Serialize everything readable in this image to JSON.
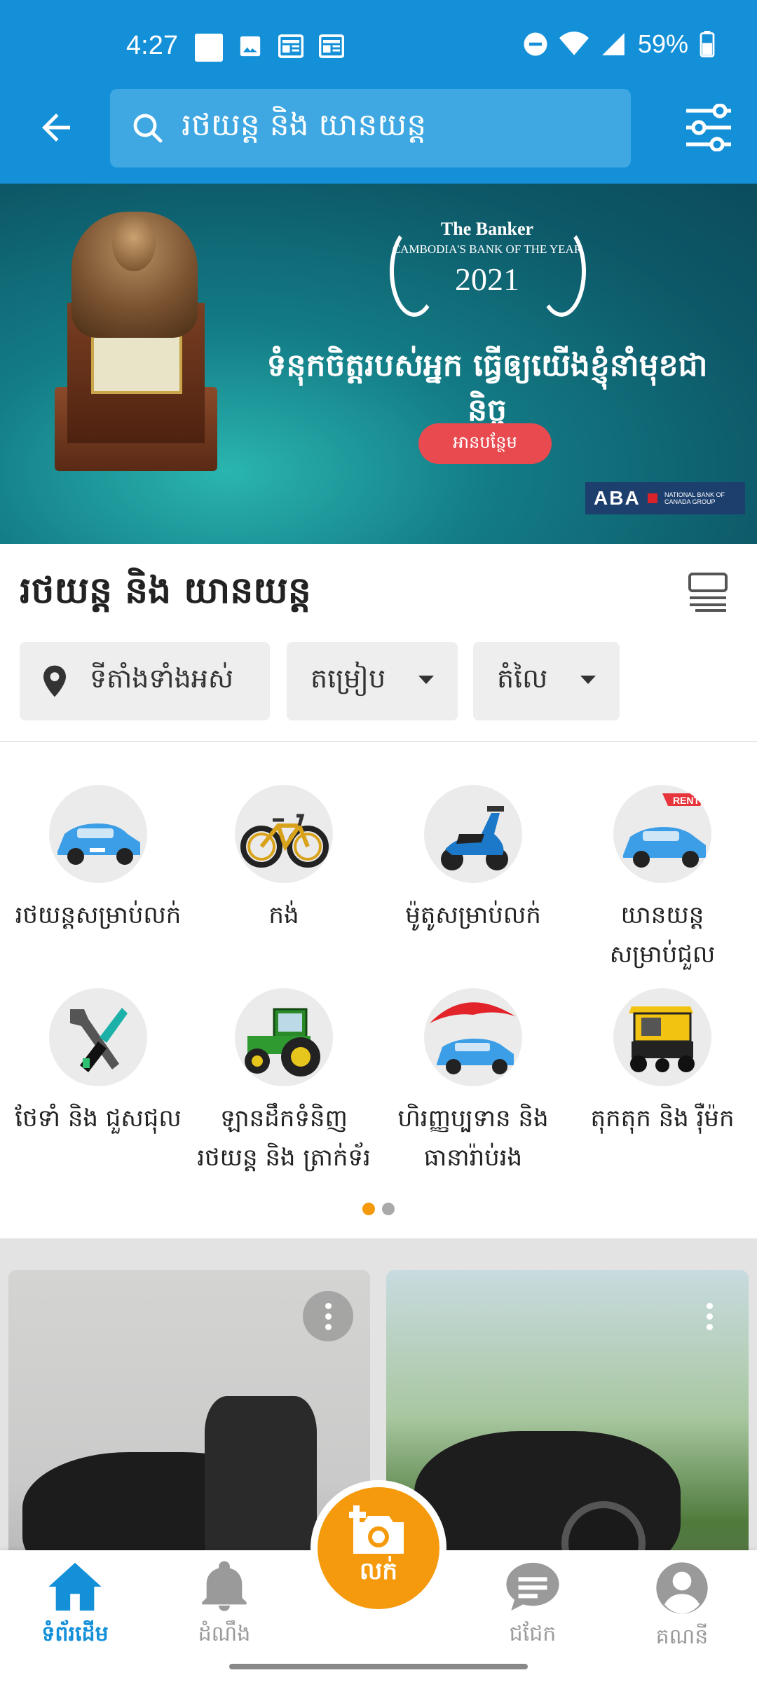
{
  "status_bar": {
    "time": "4:27",
    "battery": "59%"
  },
  "search": {
    "query": "រថយន្ត និង យានយន្ត"
  },
  "banner": {
    "publication": "The Banker",
    "award": "CAMBODIA'S BANK OF THE YEAR",
    "year": "2021",
    "slogan": "ទំនុកចិត្តរបស់អ្នក ធ្វើឲ្យយើងខ្ញុំនាំមុខជានិច្ច",
    "cta": "អានបន្ថែម",
    "brand": "ABA",
    "brand_sub": "NATIONAL BANK OF CANADA GROUP"
  },
  "section": {
    "title": "រថយន្ត និង យានយន្ត"
  },
  "filters": {
    "location": "ទីតាំងទាំងអស់",
    "sort": "តម្រៀប",
    "price": "តំលៃ"
  },
  "categories": [
    {
      "label": "រថយន្តសម្រាប់លក់",
      "icon": "car-icon"
    },
    {
      "label": "កង់",
      "icon": "bicycle-icon"
    },
    {
      "label": "ម៉ូតូសម្រាប់លក់",
      "icon": "scooter-icon"
    },
    {
      "label_line1": "យានយន្ត",
      "label_line2": "សម្រាប់ជួល",
      "icon": "rent-car-icon",
      "badge": "RENT"
    },
    {
      "label": "ថែទាំ និង ជួសជុល",
      "icon": "tools-icon"
    },
    {
      "label_line1": "ឡានដឹកទំនិញ",
      "label_line2": "រថយន្ត និង ត្រាក់ទ័រ",
      "icon": "tractor-icon"
    },
    {
      "label_line1": "ហិរញ្ញប្បទាន និង",
      "label_line2": "ធានារ៉ាប់រង",
      "icon": "insurance-icon"
    },
    {
      "label": "តុកតុក និង រ៉ឺម៉ក",
      "icon": "tuktuk-icon"
    }
  ],
  "pager": {
    "active_index": 0,
    "count": 2
  },
  "bottom_nav": {
    "home": "ទំព័រដើម",
    "notifications": "ដំណឹង",
    "sell": "លក់",
    "chat": "ជជែក",
    "account": "គណនី"
  },
  "colors": {
    "primary": "#1390d8",
    "accent": "#f59a0c",
    "banner_cta": "#e84a4f"
  }
}
